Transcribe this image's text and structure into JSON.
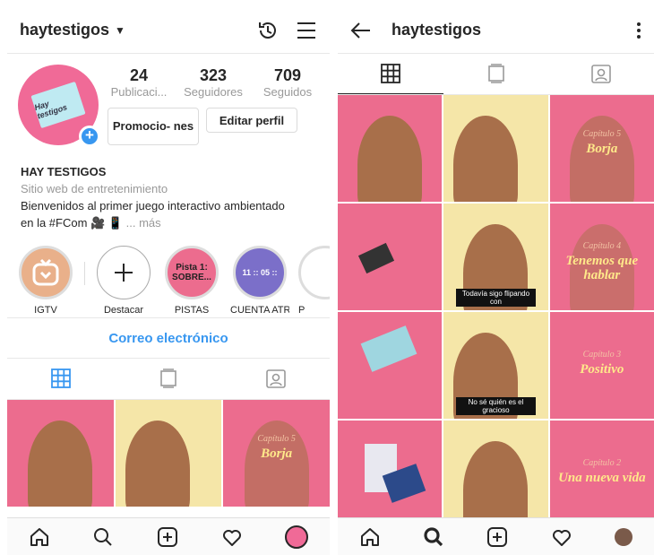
{
  "profile": {
    "username": "haytestigos",
    "avatar_text": "Hay testigos",
    "stats": [
      {
        "num": "24",
        "label": "Publicaci..."
      },
      {
        "num": "323",
        "label": "Seguidores"
      },
      {
        "num": "709",
        "label": "Seguidos"
      }
    ],
    "promo_label": "Promocio- nes",
    "edit_label": "Editar perfil",
    "name": "HAY TESTIGOS",
    "category": "Sitio web de entretenimiento",
    "bio_line1": "Bienvenidos al primer juego interactivo ambientado",
    "bio_line2": "en la #FCom 🎥 📱",
    "more": "... más",
    "highlights": [
      {
        "label": "IGTV"
      },
      {
        "label": "Destacar"
      },
      {
        "label": "PISTAS",
        "cover": "Pista 1: SOBRE..."
      },
      {
        "label": "CUENTA ATR...",
        "cover": "11 :: 05 ::"
      },
      {
        "label": "P"
      }
    ],
    "contact": "Correo electrónico"
  },
  "right": {
    "username": "haytestigos"
  },
  "captions": {
    "borja_ch": "Capítulo 5",
    "borja": "Borja",
    "tenemos_ch": "Capítulo 4",
    "tenemos": "Tenemos que hablar",
    "positivo_ch": "Capítulo 3",
    "positivo": "Positivo",
    "nueva_ch": "Capítulo 2",
    "nueva": "Una nueva vida",
    "sub1": "Todavía sigo flipando con",
    "sub2": "No sé quién es el gracioso"
  },
  "colors": {
    "accent": "#3897f0",
    "tile_pink": "#ec6c8e",
    "tile_yellow": "#f5e6a8",
    "clay": "#a86f4a"
  }
}
